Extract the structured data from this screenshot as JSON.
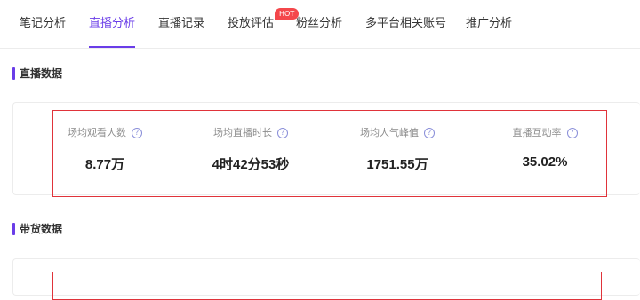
{
  "tabs": [
    {
      "label": "笔记分析"
    },
    {
      "label": "直播分析"
    },
    {
      "label": "直播记录"
    },
    {
      "label": "投放评估"
    },
    {
      "label": "粉丝分析"
    },
    {
      "label": "多平台相关账号"
    },
    {
      "label": "推广分析"
    }
  ],
  "active_tab": "直播分析",
  "hot_badge": "HOT",
  "live_section": {
    "title": "直播数据",
    "metrics": [
      {
        "label": "场均观看人数",
        "value": "8.77万"
      },
      {
        "label": "场均直播时长",
        "value": "4时42分53秒"
      },
      {
        "label": "场均人气峰值",
        "value": "1751.55万"
      },
      {
        "label": "直播互动率",
        "value": "35.02%"
      }
    ]
  },
  "sales_section": {
    "title": "带货数据"
  },
  "colors": {
    "accent": "#6a3de8",
    "highlight_border": "#e0333a",
    "hot_badge": "#f4474b"
  },
  "icons": {
    "help": "question-circle-icon"
  }
}
